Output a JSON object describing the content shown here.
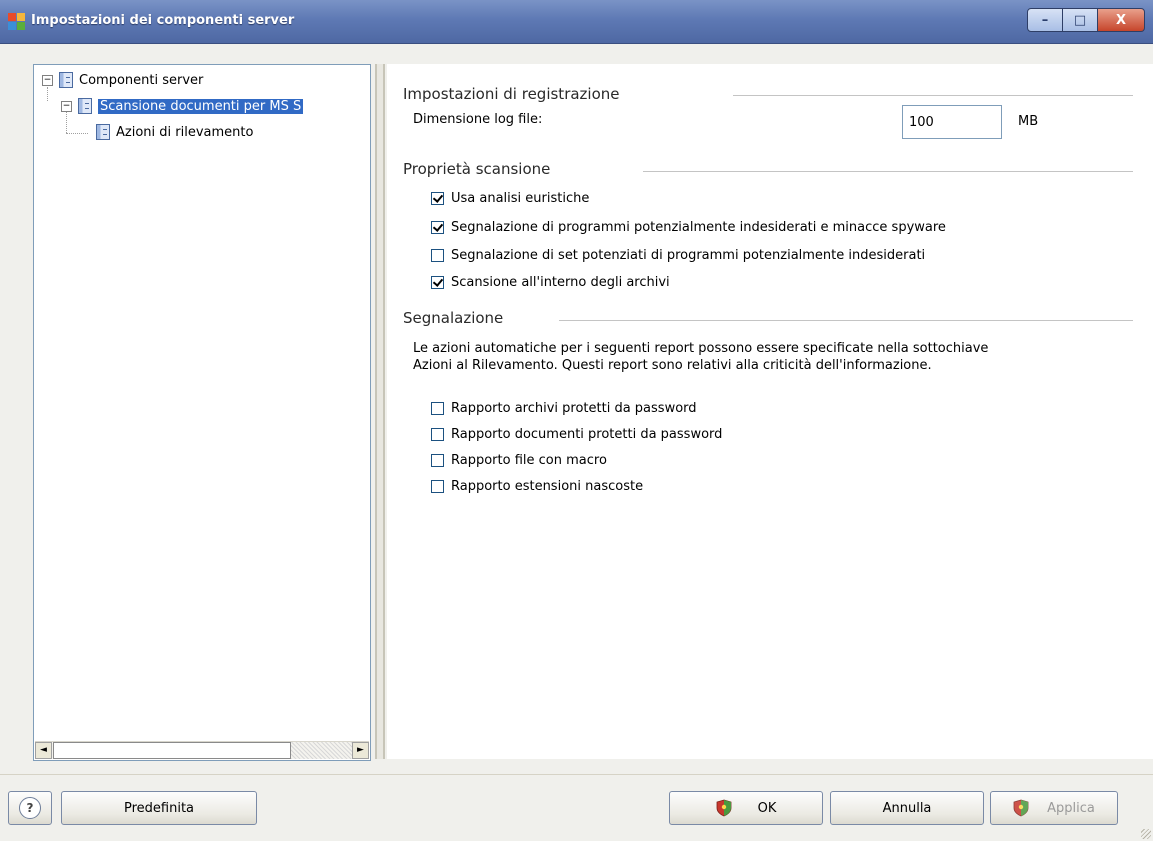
{
  "window": {
    "title": "Impostazioni dei componenti server",
    "minimize_glyph": "–",
    "maximize_glyph": "□",
    "close_glyph": "X"
  },
  "tree": {
    "root": {
      "label": "Componenti server",
      "expander": "−"
    },
    "child": {
      "label": "Scansione documenti per MS S",
      "expander": "−"
    },
    "grandchild": {
      "label": "Azioni di rilevamento"
    },
    "scroll_left": "◄",
    "scroll_right": "►"
  },
  "logging": {
    "title": "Impostazioni di registrazione",
    "log_size_label": "Dimensione log file:",
    "log_size_value": "100",
    "log_size_unit": "MB"
  },
  "scan": {
    "title": "Proprietà scansione",
    "options": [
      {
        "label": "Usa analisi euristiche",
        "checked": true
      },
      {
        "label": "Segnalazione di programmi potenzialmente indesiderati e minacce spyware",
        "checked": true
      },
      {
        "label": "Segnalazione di set potenziati di programmi potenzialmente indesiderati",
        "checked": false
      },
      {
        "label": "Scansione all'interno degli archivi",
        "checked": true
      }
    ]
  },
  "reporting": {
    "title": "Segnalazione",
    "description_line1": "Le azioni automatiche per i seguenti report possono essere specificate nella sottochiave",
    "description_line2": "Azioni al Rilevamento. Questi report sono relativi alla criticità dell'informazione.",
    "options": [
      {
        "label": "Rapporto archivi protetti da password",
        "checked": false
      },
      {
        "label": "Rapporto documenti protetti da password",
        "checked": false
      },
      {
        "label": "Rapporto file con macro",
        "checked": false
      },
      {
        "label": "Rapporto estensioni nascoste",
        "checked": false
      }
    ]
  },
  "buttons": {
    "help": "?",
    "default": "Predefinita",
    "ok": "OK",
    "cancel": "Annulla",
    "apply": "Applica"
  },
  "colors": {
    "selection": "#316ac5",
    "titlebar": "#5e79b4",
    "shield_red": "#c8372d",
    "shield_green": "#4b9a3e"
  }
}
